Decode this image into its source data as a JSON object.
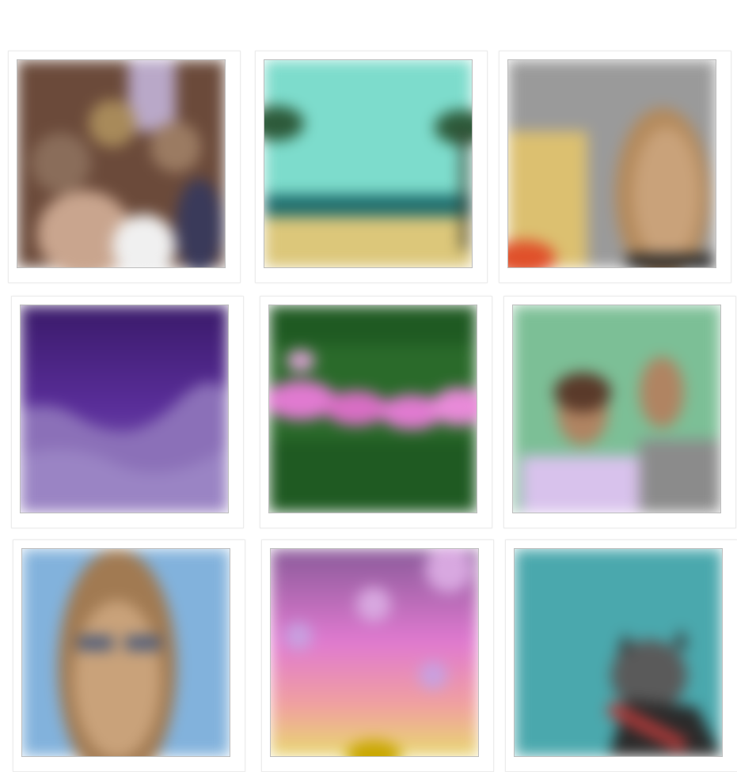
{
  "gallery": {
    "items": [
      {
        "id": "group-photo",
        "palette": {
          "bg": "#6b4a3a",
          "a": "#8a6d5a",
          "b": "#d9c6b0",
          "c": "#f0f0f0"
        }
      },
      {
        "id": "beach-scene",
        "palette": {
          "sky": "#7ddccc",
          "sea": "#1f6d6d",
          "sand": "#dcc77a",
          "palm": "#2d5a3a"
        }
      },
      {
        "id": "portrait-blonde",
        "palette": {
          "bg": "#9a9a9a",
          "hair": "#b48a5c",
          "face": "#c9a27a",
          "yellow": "#dcc070",
          "red": "#e0502a"
        }
      },
      {
        "id": "purple-landscape",
        "palette": {
          "sky": "#4a2a8a",
          "hills": "#8b70b8",
          "mist": "#a590c8"
        }
      },
      {
        "id": "floral-wreath",
        "palette": {
          "bg": "#2a6a2a",
          "flower": "#e07ad0",
          "leaf": "#1f5a22"
        }
      },
      {
        "id": "two-people",
        "palette": {
          "bg": "#7cbf96",
          "face": "#b08462",
          "shirt": "#d8c2ec",
          "grey": "#8b8b8b"
        }
      },
      {
        "id": "sunglasses-portrait",
        "palette": {
          "bg": "#82b2dc",
          "hair": "#a17a52",
          "face": "#c9a27a",
          "glasses": "#4a5a7a"
        }
      },
      {
        "id": "pastel-gradient",
        "palette": {
          "top": "#8a5a9a",
          "mid": "#e07ad0",
          "bottom": "#e8d870",
          "sun": "#c9a800"
        }
      },
      {
        "id": "dog-on-teal",
        "palette": {
          "bg": "#4aa8ad",
          "dog": "#5a5a5a",
          "collar": "#b03a3a",
          "dark": "#2a2a2a"
        }
      }
    ]
  }
}
